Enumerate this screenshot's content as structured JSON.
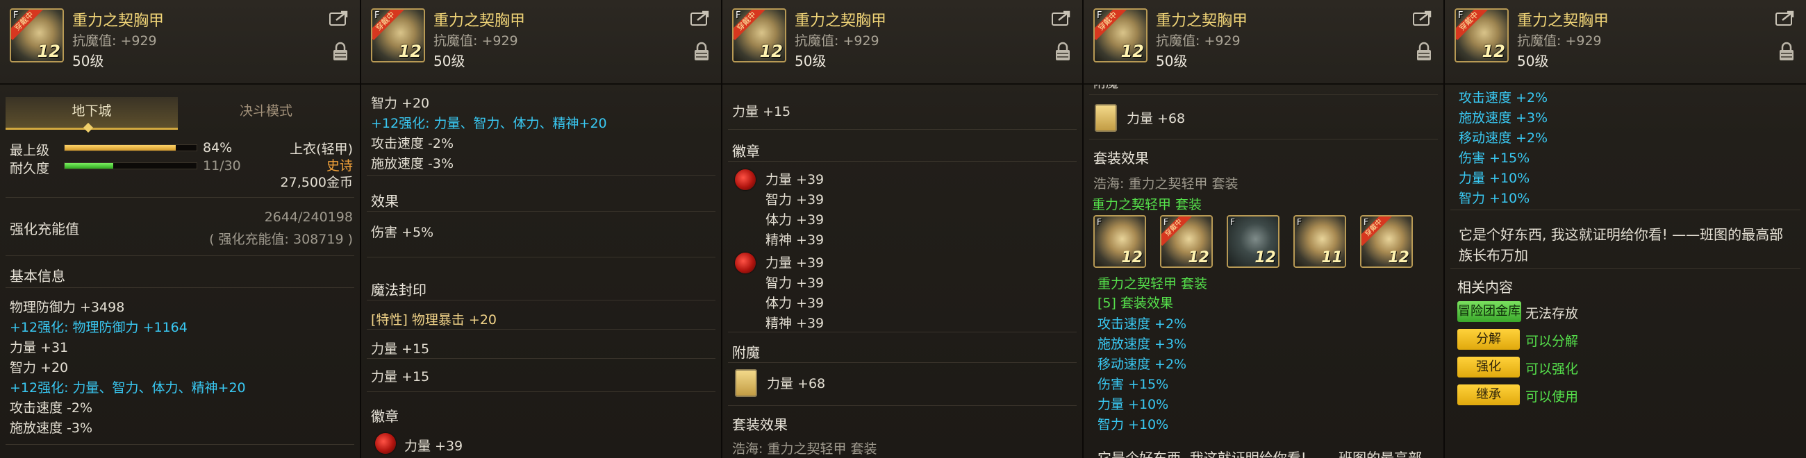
{
  "item": {
    "name": "重力之契胸甲",
    "magic_resist": "抗魔值: +929",
    "level": "50级",
    "icon_level": "12",
    "icon_ribbon": "穿戴中",
    "icon_f": "F"
  },
  "panel1": {
    "tabs": [
      "地下城",
      "决斗模式"
    ],
    "top_grade_label": "最上级",
    "top_grade_pct": "84%",
    "top_grade_value": 0.84,
    "durability_label": "耐久度",
    "durability_value": "11/30",
    "durability_fraction": 0.3667,
    "slot": "上衣(轻甲)",
    "rarity": "史诗",
    "price": "27,500金币",
    "charge_label": "强化充能值",
    "charge_value": "2644/240198",
    "charge_sub": "( 强化充能值: 308719 )",
    "basic_title": "基本信息",
    "lines": [
      {
        "text": "物理防御力 +3498",
        "color": "w"
      },
      {
        "text": "+12强化: 物理防御力 +1164",
        "color": "c"
      },
      {
        "text": "力量 +31",
        "color": "w"
      },
      {
        "text": "智力 +20",
        "color": "w"
      },
      {
        "text": "+12强化: 力量、智力、体力、精神+20",
        "color": "c"
      },
      {
        "text": "攻击速度 -2%",
        "color": "w"
      },
      {
        "text": "施放速度 -3%",
        "color": "w"
      }
    ]
  },
  "panel2": {
    "lines_top": [
      {
        "text": "智力 +20",
        "color": "w"
      },
      {
        "text": "+12强化: 力量、智力、体力、精神+20",
        "color": "c"
      },
      {
        "text": "攻击速度 -2%",
        "color": "w"
      },
      {
        "text": "施放速度 -3%",
        "color": "w"
      }
    ],
    "effect_title": "效果",
    "effect_line": "伤害 +5%",
    "seal_title": "魔法封印",
    "seal_line": "[特性] 物理暴击 +20",
    "str1": "力量 +15",
    "str2": "力量 +15",
    "emblem_title": "徽章",
    "emblem_line": "力量 +39"
  },
  "panel3": {
    "str": "力量 +15",
    "emblem_title": "徽章",
    "emblem1": [
      "力量 +39",
      "智力 +39",
      "体力 +39",
      "精神 +39"
    ],
    "emblem2": [
      "力量 +39",
      "智力 +39",
      "体力 +39",
      "精神 +39"
    ],
    "enchant_title": "附魔",
    "enchant_line": "力量 +68",
    "set_title": "套装效果",
    "set_line": "浩海: 重力之契轻甲 套装"
  },
  "panel4": {
    "enchant_title_partial": "附魔",
    "enchant_line": "力量 +68",
    "set_title": "套装效果",
    "set_line": "浩海: 重力之契轻甲 套装",
    "set_name": "重力之契轻甲 套装",
    "set_icons": [
      "12",
      "12",
      "12",
      "11",
      "12"
    ],
    "set_sub": "重力之契轻甲 套装",
    "set_count": "[5] 套装效果",
    "bonuses": [
      "攻击速度 +2%",
      "施放速度 +3%",
      "移动速度 +2%",
      "伤害 +15%",
      "力量 +10%",
      "智力 +10%"
    ],
    "quote_partial": "它是个好东西, 我这就证明给你看! ——班图的最高部"
  },
  "panel5": {
    "bonuses": [
      "攻击速度 +2%",
      "施放速度 +3%",
      "移动速度 +2%",
      "伤害 +15%",
      "力量 +10%",
      "智力 +10%"
    ],
    "quote1": "它是个好东西, 我这就证明给你看! ——班图的最高部",
    "quote2": "族长布万加",
    "related_title": "相关内容",
    "related": [
      {
        "tag": "冒险团金库",
        "text": "无法存放",
        "style": "green",
        "text_color": "w"
      },
      {
        "tag": "分解",
        "text": "可以分解",
        "style": "yellow",
        "text_color": "gr"
      },
      {
        "tag": "强化",
        "text": "可以强化",
        "style": "yellow",
        "text_color": "gr"
      },
      {
        "tag": "继承",
        "text": "可以使用",
        "style": "yellow",
        "text_color": "gr"
      }
    ]
  }
}
